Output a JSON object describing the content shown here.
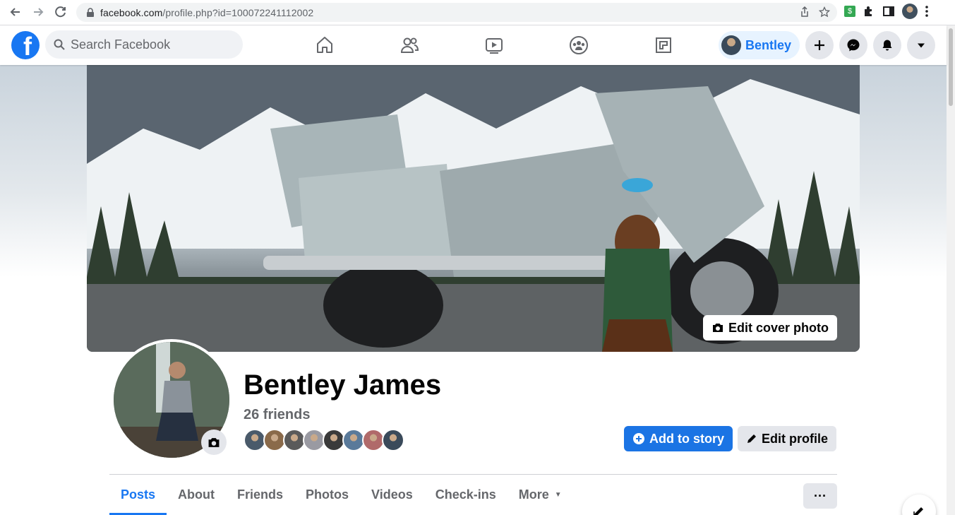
{
  "browser": {
    "url_domain": "facebook.com",
    "url_path": "/profile.php?id=100072241112002"
  },
  "header": {
    "logo_letter": "f",
    "search_placeholder": "Search Facebook",
    "nav_items": [
      "home-icon",
      "friends-icon",
      "watch-icon",
      "groups-icon",
      "gaming-icon"
    ],
    "profile_chip_name": "Bentley",
    "accent_color": "#1877f2"
  },
  "cover": {
    "edit_label": "Edit cover photo"
  },
  "profile": {
    "name": "Bentley James",
    "friend_count": "26 friends",
    "add_story_label": "Add to story",
    "edit_profile_label": "Edit profile",
    "friend_avatar_colors": [
      "#4a5a6a",
      "#8a6a4a",
      "#5a5a5a",
      "#9a9aa2",
      "#3a3a3a",
      "#5a7a9a",
      "#b06a6a",
      "#3a4a5a"
    ]
  },
  "tabs": [
    {
      "label": "Posts",
      "active": true
    },
    {
      "label": "About",
      "active": false
    },
    {
      "label": "Friends",
      "active": false
    },
    {
      "label": "Photos",
      "active": false
    },
    {
      "label": "Videos",
      "active": false
    },
    {
      "label": "Check-ins",
      "active": false
    },
    {
      "label": "More",
      "active": false
    }
  ],
  "more_button": "···"
}
